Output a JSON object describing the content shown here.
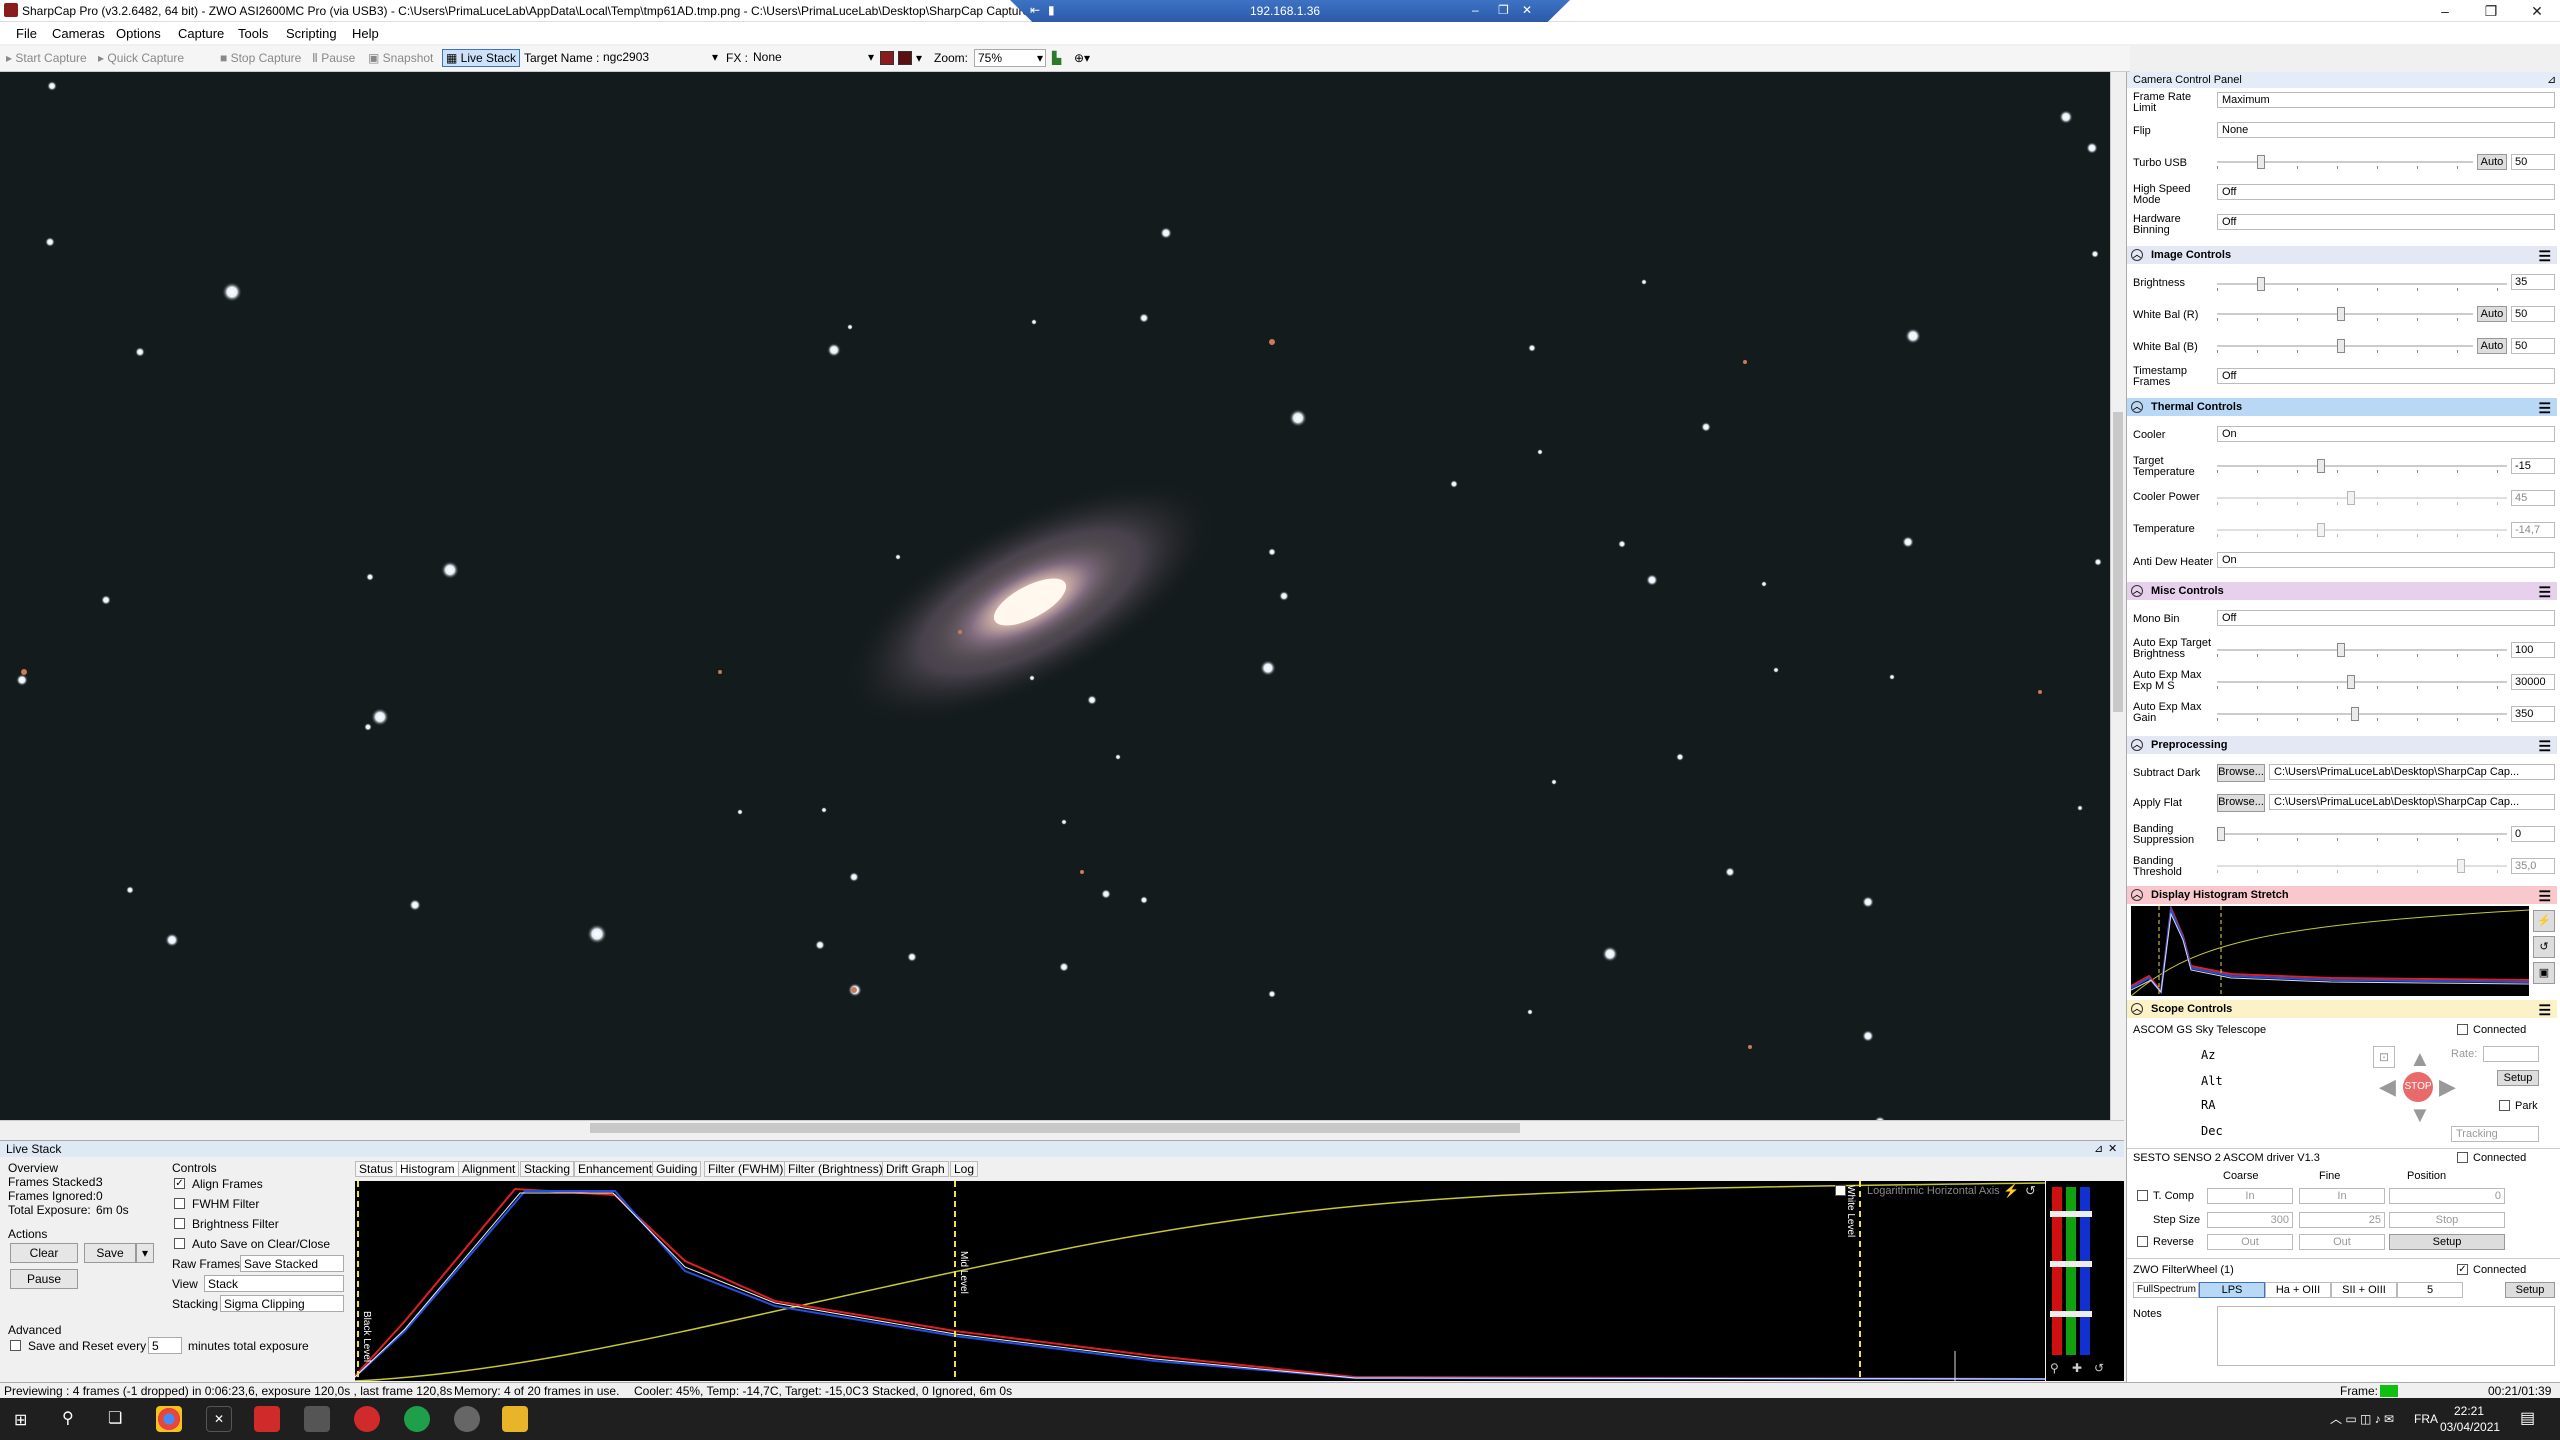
{
  "window": {
    "title": "SharpCap Pro (v3.2.6482, 64 bit) - ZWO ASI2600MC Pro (via USB3) - C:\\Users\\PrimaLuceLab\\AppData\\Local\\Temp\\tmp61AD.tmp.png - C:\\Users\\PrimaLuceLab\\Desktop\\SharpCap Capture",
    "remote_ip": "192.168.1.36"
  },
  "menu": [
    "File",
    "Cameras",
    "Options",
    "Capture",
    "Tools",
    "Scripting",
    "Help"
  ],
  "toolbar": {
    "start_capture": "Start Capture",
    "quick_capture": "Quick Capture",
    "stop_capture": "Stop Capture",
    "pause": "Pause",
    "snapshot": "Snapshot",
    "live_stack": "Live Stack",
    "target_label": "Target Name :",
    "target_value": "ngc2903",
    "fx_label": "FX :",
    "fx_value": "None",
    "zoom_label": "Zoom:",
    "zoom_value": "75%"
  },
  "livestack": {
    "title": "Live Stack",
    "overview": "Overview",
    "frames_stacked_label": "Frames Stacked:",
    "frames_stacked": "3",
    "frames_ignored_label": "Frames Ignored:",
    "frames_ignored": "0",
    "total_exposure_label": "Total Exposure:",
    "total_exposure": "6m 0s",
    "actions": "Actions",
    "clear": "Clear",
    "save": "Save",
    "pause": "Pause",
    "advanced": "Advanced",
    "save_reset": "Save and Reset every",
    "save_reset_value": "5",
    "minutes": "minutes total exposure",
    "controls": "Controls",
    "align": "Align Frames",
    "fwhm": "FWHM Filter",
    "brightness": "Brightness Filter",
    "autosave": "Auto Save on Clear/Close",
    "raw_frames_label": "Raw Frames",
    "raw_frames": "Save Stacked",
    "view_label": "View",
    "view": "Stack",
    "stacking_label": "Stacking",
    "stacking": "Sigma Clipping",
    "tabs": [
      "Status",
      "Histogram",
      "Alignment",
      "Stacking",
      "Enhancement",
      "Guiding",
      "Filter (FWHM)",
      "Filter (Brightness)",
      "Drift Graph",
      "Log"
    ],
    "black_level": "Black Level",
    "mid_level": "Mid Level",
    "white_level": "White Level",
    "log_axis": "Logarithmic Horizontal Axis"
  },
  "status": {
    "preview": "Previewing : 4 frames (-1 dropped) in 0:06:23,6, exposure 120,0s , last frame 120,8s",
    "memory": "Memory: 4 of 20 frames in use.",
    "cooler": "Cooler: 45%, Temp: -14,7C, Target: -15,0C",
    "stacked": "3 Stacked, 0 Ignored, 6m 0s",
    "frame_label": "Frame:",
    "frame_time": "00:21/01:39"
  },
  "panel": {
    "title": "Camera Control Panel",
    "frame_rate_label": "Frame Rate Limit",
    "frame_rate": "Maximum",
    "flip_label": "Flip",
    "flip": "None",
    "turbo_label": "Turbo USB",
    "turbo_auto": "Auto",
    "turbo": "50",
    "hsm_label": "High Speed Mode",
    "hsm": "Off",
    "hwbin_label": "Hardware Binning",
    "hwbin": "Off",
    "image_controls": "Image Controls",
    "brightness_label": "Brightness",
    "brightness": "35",
    "wbr_label": "White Bal (R)",
    "wbr_auto": "Auto",
    "wbr": "50",
    "wbb_label": "White Bal (B)",
    "wbb_auto": "Auto",
    "wbb": "50",
    "timestamp_label": "Timestamp Frames",
    "timestamp": "Off",
    "thermal": "Thermal Controls",
    "cooler_label": "Cooler",
    "cooler": "On",
    "target_temp_label": "Target Temperature",
    "target_temp": "-15",
    "cooler_power_label": "Cooler Power",
    "cooler_power": "45",
    "temperature_label": "Temperature",
    "temperature": "-14,7",
    "antidew_label": "Anti Dew Heater",
    "antidew": "On",
    "misc": "Misc Controls",
    "monobin_label": "Mono Bin",
    "monobin": "Off",
    "aetb_label": "Auto Exp Target Brightness",
    "aetb": "100",
    "aeme_label": "Auto Exp Max Exp M S",
    "aeme": "30000",
    "aemg_label": "Auto Exp Max Gain",
    "aemg": "350",
    "preprocessing": "Preprocessing",
    "dark_label": "Subtract Dark",
    "browse": "Browse...",
    "dark_path": "C:\\Users\\PrimaLuceLab\\Desktop\\SharpCap Cap...",
    "flat_label": "Apply Flat",
    "flat_path": "C:\\Users\\PrimaLuceLab\\Desktop\\SharpCap Cap...",
    "banding_sup_label": "Banding Suppression",
    "banding_sup": "0",
    "banding_thr_label": "Banding Threshold",
    "banding_thr": "35,0",
    "display_histo": "Display Histogram Stretch",
    "scope": "Scope Controls",
    "ascom": "ASCOM GS Sky Telescope",
    "connected": "Connected",
    "az": "Az",
    "alt": "Alt",
    "ra": "RA",
    "dec": "Dec",
    "rate": "Rate:",
    "setup": "Setup",
    "park": "Park",
    "tracking": "Tracking",
    "stop": "STOP",
    "focuser": "SESTO SENSO 2 ASCOM driver V1.3",
    "coarse": "Coarse",
    "fine": "Fine",
    "position": "Position",
    "tcomp": "T. Comp",
    "in": "In",
    "pos_val": "0",
    "step_size": "Step Size",
    "coarse_step": "300",
    "fine_step": "25",
    "stop_btn": "Stop",
    "reverse": "Reverse",
    "out": "Out",
    "filterwheel": "ZWO FilterWheel (1)",
    "filters": [
      "FullSpectrum",
      "LPS",
      "Ha + OIII",
      "SII + OIII",
      "5"
    ],
    "notes": "Notes"
  },
  "taskbar": {
    "lang": "FRA",
    "time": "22:21",
    "date": "03/04/2021"
  },
  "colors": {
    "accent": "#3d73c4",
    "thermal": "#b8d8f6",
    "misc": "#e6d0ec",
    "display": "#f8c8cc",
    "scope": "#fbf2c8",
    "image": "#e4e8f4",
    "pre": "#e4e8f4"
  }
}
